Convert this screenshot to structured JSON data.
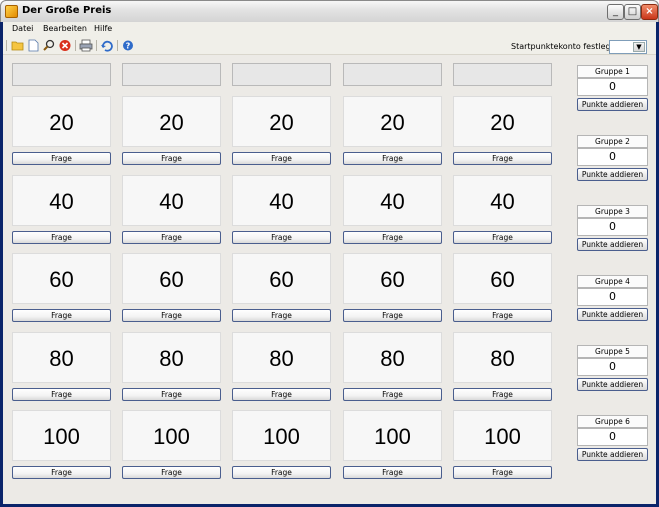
{
  "window": {
    "title": "Der Große Preis"
  },
  "menu": [
    "Datei",
    "Bearbeiten",
    "Hilfe"
  ],
  "toolbar": {
    "icons": [
      "open-folder-icon",
      "new-document-icon",
      "search-icon",
      "stop-icon",
      "print-icon",
      "refresh-icon",
      "help-icon"
    ],
    "start_label": "Startpunktekonto festlegen:",
    "start_value": ""
  },
  "board": {
    "rows": [
      {
        "value": "20",
        "button": "Frage"
      },
      {
        "value": "40",
        "button": "Frage"
      },
      {
        "value": "60",
        "button": "Frage"
      },
      {
        "value": "80",
        "button": "Frage"
      },
      {
        "value": "100",
        "button": "Frage"
      }
    ],
    "columns": 5
  },
  "groups": [
    {
      "label": "Gruppe 1",
      "score": "0",
      "button": "Punkte addieren"
    },
    {
      "label": "Gruppe 2",
      "score": "0",
      "button": "Punkte addieren"
    },
    {
      "label": "Gruppe 3",
      "score": "0",
      "button": "Punkte addieren"
    },
    {
      "label": "Gruppe 4",
      "score": "0",
      "button": "Punkte addieren"
    },
    {
      "label": "Gruppe 5",
      "score": "0",
      "button": "Punkte addieren"
    },
    {
      "label": "Gruppe 6",
      "score": "0",
      "button": "Punkte addieren"
    }
  ],
  "colors": {
    "titlebar": "#e2e2e2",
    "client": "#eceae6",
    "button_border": "#4a5e8e",
    "close_button": "#c9361a"
  }
}
